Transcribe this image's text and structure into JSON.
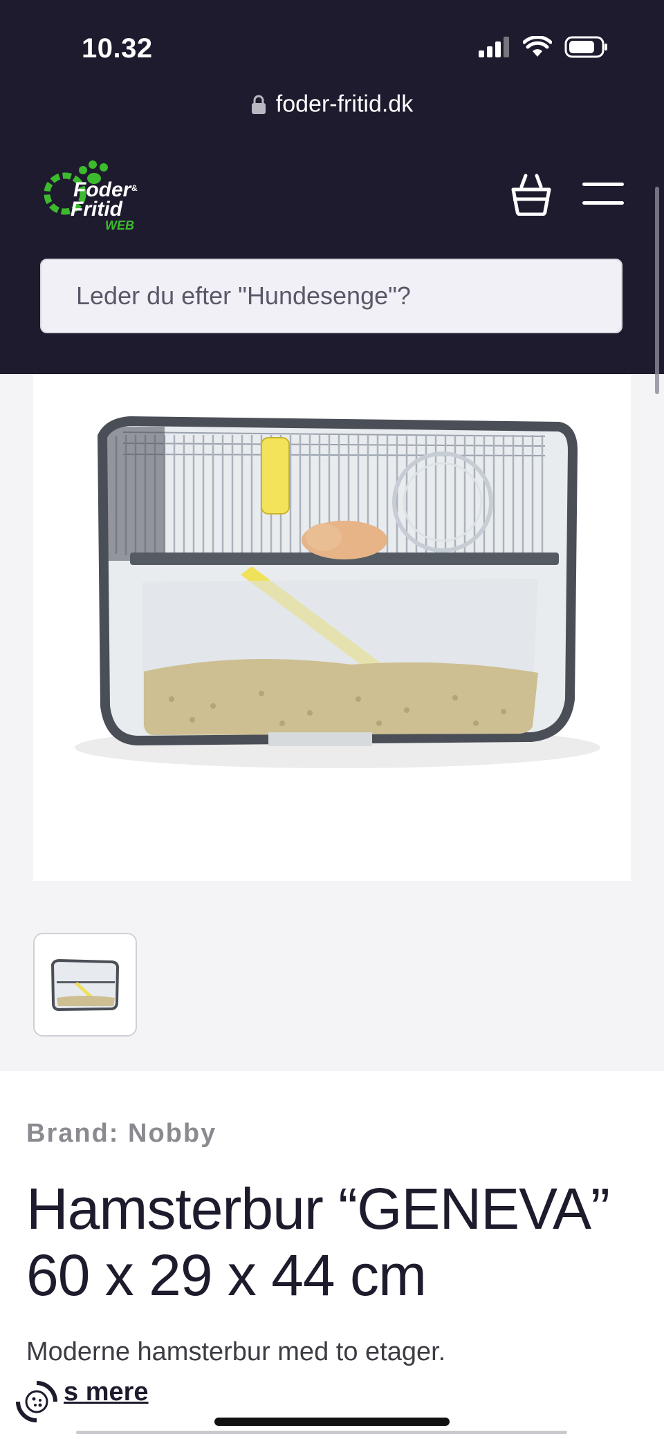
{
  "status_bar": {
    "time": "10.32"
  },
  "browser": {
    "url": "foder-fritid.dk"
  },
  "site": {
    "logo": {
      "line1": "Foder",
      "amp": "&",
      "line2": "Fritid",
      "line3": "WEB"
    },
    "search": {
      "placeholder": "Leder du efter \"Hundesenge\"?"
    }
  },
  "product": {
    "brand": "Brand: Nobby",
    "title_line1": "Hamsterbur “GENEVA”",
    "title_line2": "60 x 29 x 44 cm",
    "description": "Moderne hamsterbur med to etager.",
    "read_more": "s mere"
  },
  "colors": {
    "header_bg": "#1e1b2e",
    "brand_green": "#3dbb2e",
    "page_bg": "#f4f4f7"
  },
  "icons": {
    "lock": "lock-icon",
    "cart": "basket-icon",
    "menu": "hamburger-menu-icon",
    "cookie": "cookie-settings-icon"
  }
}
